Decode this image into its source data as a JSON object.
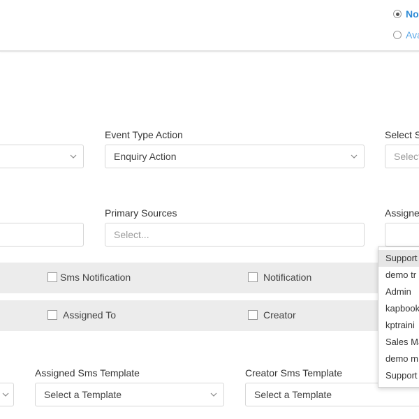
{
  "header": {
    "radio_options": [
      {
        "label": "No",
        "checked": true
      },
      {
        "label": "Ava",
        "checked": false
      }
    ]
  },
  "form": {
    "left_select_1": {
      "value": ""
    },
    "event_type_action": {
      "label": "Event Type Action",
      "value": "Enquiry Action"
    },
    "select_s": {
      "label": "Select S",
      "placeholder": "Select"
    },
    "left_input_2": {
      "value": ""
    },
    "primary_sources": {
      "label": "Primary Sources",
      "placeholder": "Select..."
    },
    "assigned": {
      "label": "Assigne",
      "value": ""
    }
  },
  "notifications_row": {
    "sms_notification": {
      "label": "Sms Notification",
      "checked": false
    },
    "notification": {
      "label": "Notification",
      "checked": false
    }
  },
  "recipients_row": {
    "assigned_to": {
      "label": "Assigned To",
      "checked": false
    },
    "creator": {
      "label": "Creator",
      "checked": false
    }
  },
  "templates": {
    "assigned_sms_template": {
      "label": "Assigned Sms Template",
      "placeholder": "Select a Template"
    },
    "creator_sms_template": {
      "label": "Creator Sms Template",
      "placeholder": "Select a Template"
    }
  },
  "assigned_dropdown": {
    "options": [
      "Support",
      "demo tr",
      "Admin",
      "kapbook",
      "kptraini",
      "Sales Ma",
      "demo m",
      "Support"
    ],
    "highlighted_index": 0
  },
  "colors": {
    "accent_blue": "#2d8ad6",
    "band_gray": "#ececec",
    "border_gray": "#d7d7d7"
  }
}
